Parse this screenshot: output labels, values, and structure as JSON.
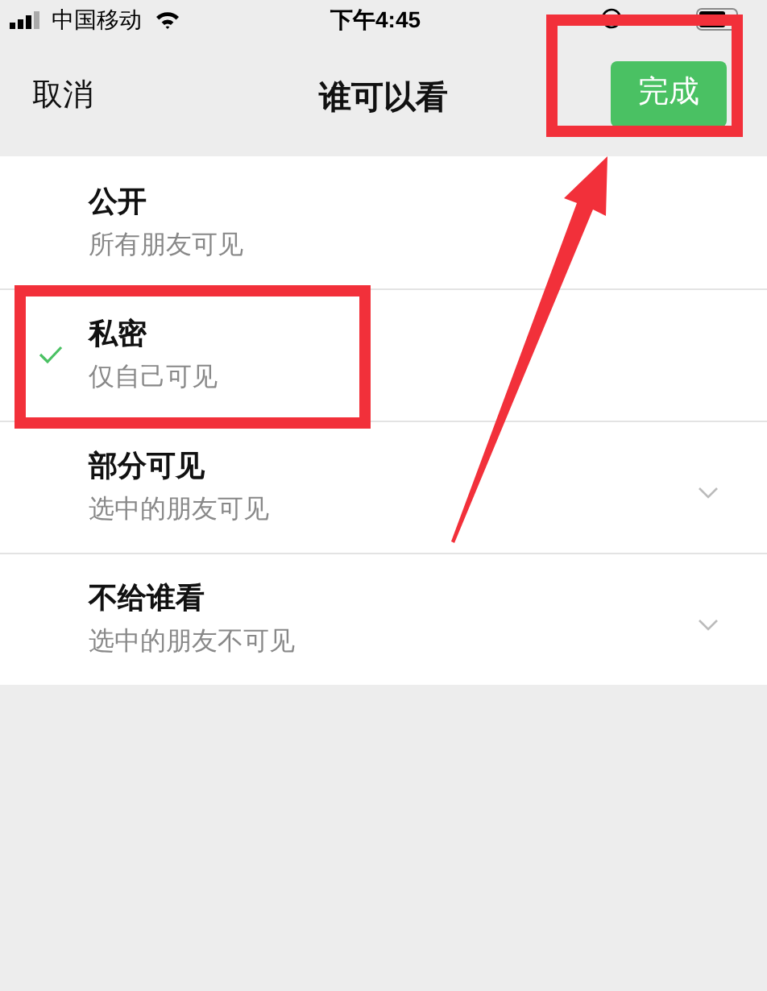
{
  "status_bar": {
    "carrier": "中国移动",
    "time": "下午4:45"
  },
  "nav": {
    "cancel": "取消",
    "title": "谁可以看",
    "done": "完成"
  },
  "options": [
    {
      "title": "公开",
      "subtitle": "所有朋友可见",
      "selected": false,
      "expandable": false
    },
    {
      "title": "私密",
      "subtitle": "仅自己可见",
      "selected": true,
      "expandable": false
    },
    {
      "title": "部分可见",
      "subtitle": "选中的朋友可见",
      "selected": false,
      "expandable": true
    },
    {
      "title": "不给谁看",
      "subtitle": "选中的朋友不可见",
      "selected": false,
      "expandable": true
    }
  ]
}
